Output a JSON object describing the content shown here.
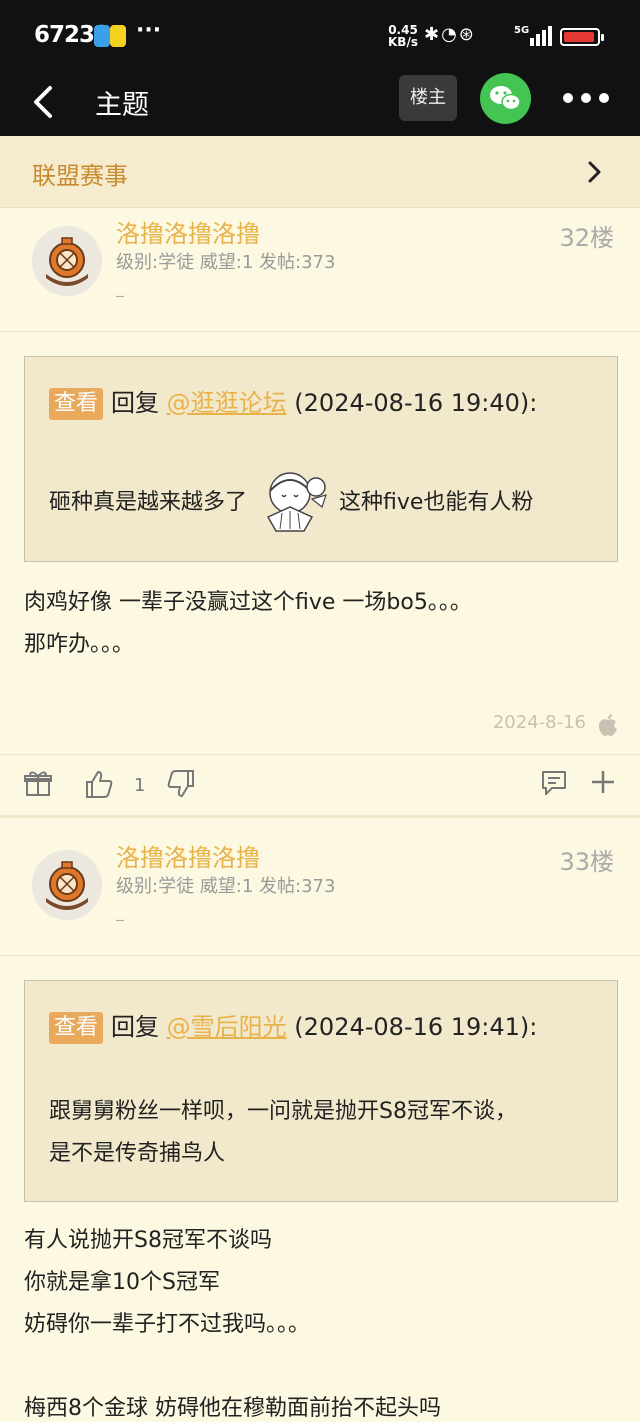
{
  "status_bar": {
    "time": "67233",
    "speed_value": "0.45",
    "speed_unit": "KB/s"
  },
  "nav": {
    "title": "主题",
    "owner_label": "楼主"
  },
  "section": {
    "label": "联盟赛事"
  },
  "posts": [
    {
      "username": "洛撸洛撸洛撸",
      "meta": "级别:学徒  威望:1  发帖:373",
      "dash": "_",
      "floor": "32楼",
      "quote": {
        "view_label": "查看",
        "reply_prefix": "回复",
        "reply_user": "@逛逛论坛",
        "reply_time": "(2024-08-16 19:40):",
        "text_before": "砸种真是越来越多了",
        "text_after": "这种five也能有人粉"
      },
      "body_lines": [
        "肉鸡好像 一辈子没赢过这个five 一场bo5。。。",
        "那咋办。。。"
      ],
      "date": "2024-8-16",
      "like_count": "1"
    },
    {
      "username": "洛撸洛撸洛撸",
      "meta": "级别:学徒  威望:1  发帖:373",
      "dash": "_",
      "floor": "33楼",
      "quote": {
        "view_label": "查看",
        "reply_prefix": "回复",
        "reply_user": "@雪后阳光",
        "reply_time": "(2024-08-16 19:41):",
        "lines": [
          "跟舅舅粉丝一样呗，一问就是抛开S8冠军不谈，",
          "是不是传奇捕鸟人"
        ]
      },
      "body_lines": [
        "有人说抛开S8冠军不谈吗",
        "你就是拿10个S冠军",
        "妨碍你一辈子打不过我吗。。。",
        "",
        "梅西8个金球 妨碍他在穆勒面前抬不起头吗"
      ]
    }
  ]
}
